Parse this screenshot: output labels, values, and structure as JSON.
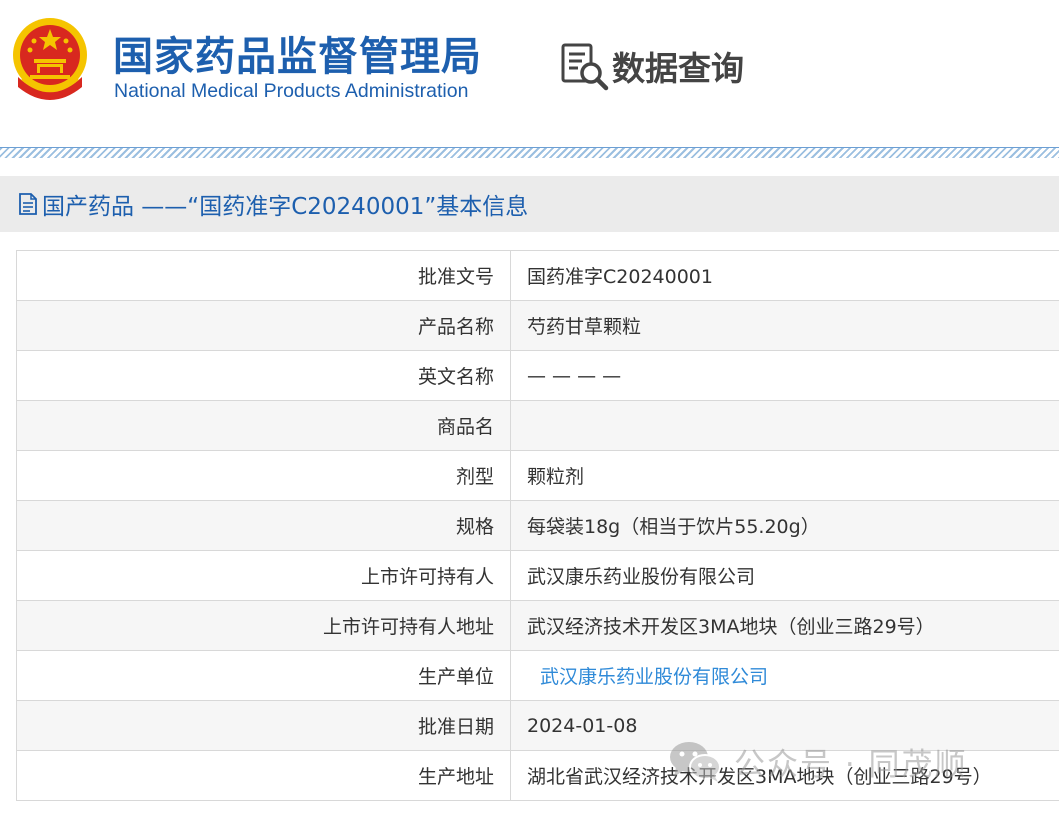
{
  "header": {
    "title_cn": "国家药品监督管理局",
    "title_en": "National Medical Products Administration",
    "query_label": "数据查询",
    "emblem_icon": "national-emblem-icon",
    "query_icon": "document-search-icon"
  },
  "section": {
    "title": "国产药品 ——“国药准字C20240001”基本信息",
    "icon": "document-icon"
  },
  "rows": [
    {
      "label": "批准文号",
      "value": "国药准字C20240001"
    },
    {
      "label": "产品名称",
      "value": "芍药甘草颗粒"
    },
    {
      "label": "英文名称",
      "value": "— — — —"
    },
    {
      "label": "商品名",
      "value": ""
    },
    {
      "label": "剂型",
      "value": "颗粒剂"
    },
    {
      "label": "规格",
      "value": "每袋装18g（相当于饮片55.20g）"
    },
    {
      "label": "上市许可持有人",
      "value": "武汉康乐药业股份有限公司"
    },
    {
      "label": "上市许可持有人地址",
      "value": "武汉经济技术开发区3MA地块（创业三路29号）"
    },
    {
      "label": "生产单位",
      "value": "武汉康乐药业股份有限公司"
    },
    {
      "label": "批准日期",
      "value": "2024-01-08"
    },
    {
      "label": "生产地址",
      "value": "湖北省武汉经济技术开发区3MA地块（创业三路29号）"
    }
  ],
  "watermark": {
    "text": "公众号 · 同茂顺",
    "icon": "wechat-icon"
  },
  "colors": {
    "brand_blue": "#1d5fae",
    "link_blue": "#2f8ad8",
    "emblem_red": "#d8281f",
    "emblem_gold": "#f5c400"
  }
}
